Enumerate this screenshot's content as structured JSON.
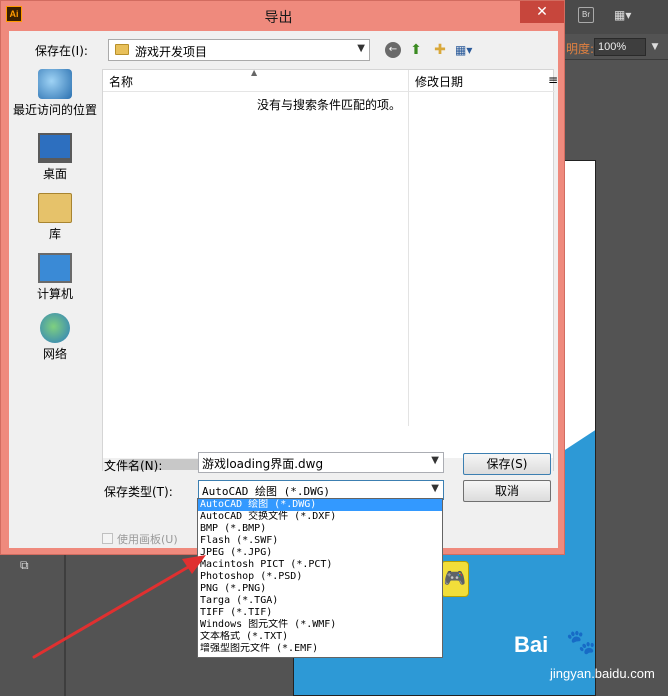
{
  "app": {
    "top_buttons": {
      "bridge": "Br",
      "layout": "▦▾"
    },
    "opacity": {
      "label": "明度:",
      "value": "100%"
    }
  },
  "dialog": {
    "app_icon": "Ai",
    "title": "导出",
    "close_glyph": "✕",
    "save_in": {
      "label": "保存在(I):",
      "value": "游戏开发项目"
    },
    "toolbar": {
      "back": "←",
      "up": "⬆",
      "new_folder": "✚",
      "view": "▦▾"
    },
    "places": [
      {
        "label": "最近访问的位置",
        "icon": "recent-places-icon"
      },
      {
        "label": "桌面",
        "icon": "desktop-icon"
      },
      {
        "label": "库",
        "icon": "library-icon"
      },
      {
        "label": "计算机",
        "icon": "computer-icon"
      },
      {
        "label": "网络",
        "icon": "network-icon"
      }
    ],
    "file_list": {
      "columns": [
        "名称",
        "修改日期",
        "≡"
      ],
      "empty_message": "没有与搜索条件匹配的项。"
    },
    "filename": {
      "label": "文件名(N):",
      "value": "游戏loading界面.dwg"
    },
    "save_type": {
      "label": "保存类型(T):",
      "value": "AutoCAD 绘图 (*.DWG)"
    },
    "buttons": {
      "save": "保存(S)",
      "cancel": "取消"
    },
    "artboard_checkbox": "使用画板(U)",
    "type_options": [
      "AutoCAD 绘图 (*.DWG)",
      "AutoCAD 交换文件 (*.DXF)",
      "BMP (*.BMP)",
      "Flash (*.SWF)",
      "JPEG (*.JPG)",
      "Macintosh PICT (*.PCT)",
      "Photoshop (*.PSD)",
      "PNG (*.PNG)",
      "Targa (*.TGA)",
      "TIFF (*.TIF)",
      "Windows 图元文件 (*.WMF)",
      "文本格式 (*.TXT)",
      "增强型图元文件 (*.EMF)"
    ],
    "selected_option": 0
  },
  "watermark": {
    "line1": "Bai",
    "line2": "jingyan.baidu.com",
    "paw": "🐾"
  },
  "colors": {
    "dialog_frame": "#ef8a7d",
    "selection": "#3399ff",
    "annotation": "#e03030"
  }
}
